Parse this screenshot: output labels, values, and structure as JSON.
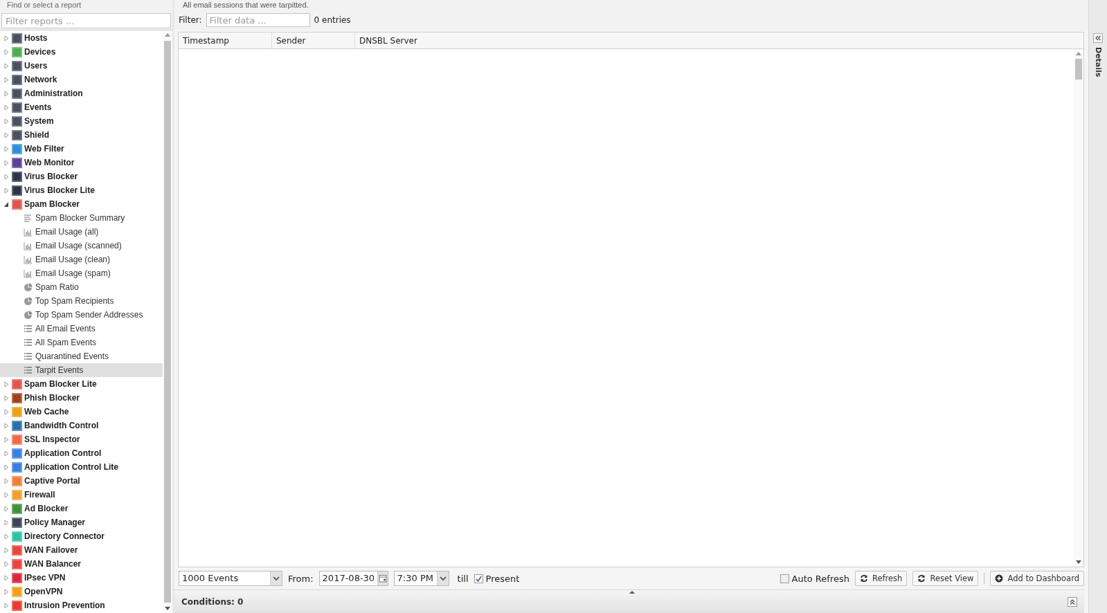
{
  "sidebar": {
    "heading": "Find or select a report",
    "search": {
      "placeholder": "Filter reports ..."
    },
    "items": [
      {
        "label": "Hosts",
        "color": "#4a5060",
        "expanded": false
      },
      {
        "label": "Devices",
        "color": "#4caf50",
        "expanded": false
      },
      {
        "label": "Users",
        "color": "#4a5060",
        "expanded": false
      },
      {
        "label": "Network",
        "color": "#4a5060",
        "expanded": false
      },
      {
        "label": "Administration",
        "color": "#4a5060",
        "expanded": false
      },
      {
        "label": "Events",
        "color": "#4a5060",
        "expanded": false
      },
      {
        "label": "System",
        "color": "#4a5060",
        "expanded": false
      },
      {
        "label": "Shield",
        "color": "#4a5060",
        "expanded": false
      },
      {
        "label": "Web Filter",
        "color": "#2e8fd8",
        "expanded": false
      },
      {
        "label": "Web Monitor",
        "color": "#5b3f9a",
        "expanded": false
      },
      {
        "label": "Virus Blocker",
        "color": "#2b3548",
        "expanded": false
      },
      {
        "label": "Virus Blocker Lite",
        "color": "#2b3548",
        "expanded": false
      },
      {
        "label": "Spam Blocker",
        "color": "#e0564b",
        "expanded": true,
        "children": [
          {
            "label": "Spam Blocker Summary",
            "kind": "text",
            "selected": false
          },
          {
            "label": "Email Usage (all)",
            "kind": "bar",
            "selected": false
          },
          {
            "label": "Email Usage (scanned)",
            "kind": "bar",
            "selected": false
          },
          {
            "label": "Email Usage (clean)",
            "kind": "bar",
            "selected": false
          },
          {
            "label": "Email Usage (spam)",
            "kind": "bar",
            "selected": false
          },
          {
            "label": "Spam Ratio",
            "kind": "pie",
            "selected": false
          },
          {
            "label": "Top Spam Recipients",
            "kind": "pie",
            "selected": false
          },
          {
            "label": "Top Spam Sender Addresses",
            "kind": "pie",
            "selected": false
          },
          {
            "label": "All Email Events",
            "kind": "list",
            "selected": false
          },
          {
            "label": "All Spam Events",
            "kind": "list",
            "selected": false
          },
          {
            "label": "Quarantined Events",
            "kind": "list",
            "selected": false
          },
          {
            "label": "Tarpit Events",
            "kind": "list",
            "selected": true
          }
        ]
      },
      {
        "label": "Spam Blocker Lite",
        "color": "#e0564b",
        "expanded": false
      },
      {
        "label": "Phish Blocker",
        "color": "#a0401c",
        "expanded": false
      },
      {
        "label": "Web Cache",
        "color": "#e8a317",
        "expanded": false
      },
      {
        "label": "Bandwidth Control",
        "color": "#2a6fa8",
        "expanded": false
      },
      {
        "label": "SSL Inspector",
        "color": "#f06a4a",
        "expanded": false
      },
      {
        "label": "Application Control",
        "color": "#3b7fe0",
        "expanded": false
      },
      {
        "label": "Application Control Lite",
        "color": "#3b7fe0",
        "expanded": false
      },
      {
        "label": "Captive Portal",
        "color": "#f07f3c",
        "expanded": false
      },
      {
        "label": "Firewall",
        "color": "#f0a030",
        "expanded": false
      },
      {
        "label": "Ad Blocker",
        "color": "#3f8f3f",
        "expanded": false
      },
      {
        "label": "Policy Manager",
        "color": "#3c4454",
        "expanded": false
      },
      {
        "label": "Directory Connector",
        "color": "#2ec4a4",
        "expanded": false
      },
      {
        "label": "WAN Failover",
        "color": "#e8463c",
        "expanded": false
      },
      {
        "label": "WAN Balancer",
        "color": "#e8463c",
        "expanded": false
      },
      {
        "label": "IPsec VPN",
        "color": "#d8283c",
        "expanded": false
      },
      {
        "label": "OpenVPN",
        "color": "#f0a020",
        "expanded": false
      },
      {
        "label": "Intrusion Prevention",
        "color": "#e83c30",
        "expanded": false
      }
    ]
  },
  "report": {
    "description": "All email sessions that were tarpitted.",
    "filter": {
      "label": "Filter:",
      "placeholder": "Filter data ...",
      "count": "0 entries"
    },
    "table": {
      "columns": [
        "Timestamp",
        "Sender",
        "DNSBL Server"
      ]
    },
    "toolbar": {
      "limit": "1000 Events",
      "from_label": "From:",
      "date": "2017-08-30",
      "time": "7:30 PM",
      "till_label": "till",
      "present": {
        "label": "Present",
        "checked": true
      },
      "auto_refresh": {
        "label": "Auto Refresh",
        "checked": false
      },
      "buttons": [
        "Refresh",
        "Reset View",
        "Add to Dashboard"
      ]
    },
    "conditions": "Conditions: 0"
  },
  "details_tab": "Details"
}
